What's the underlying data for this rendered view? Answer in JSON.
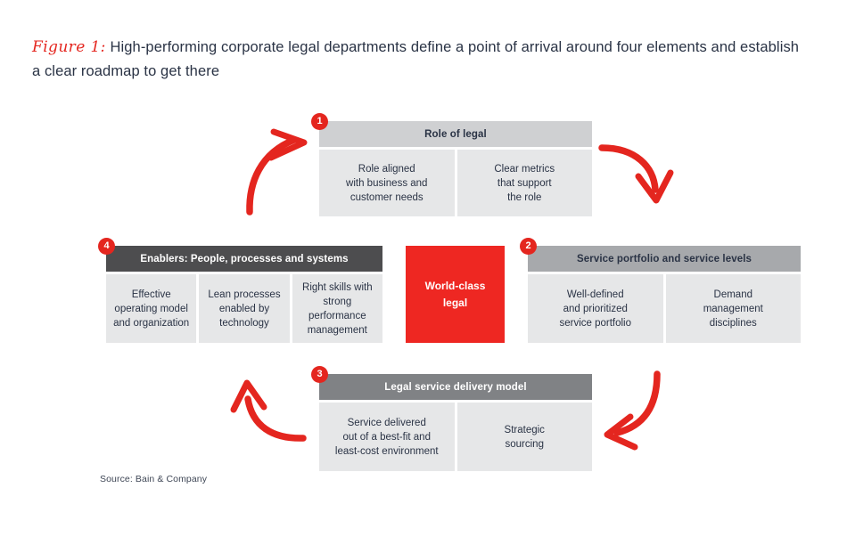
{
  "figure": {
    "label": "Figure 1:",
    "title": "High-performing corporate legal departments define a point of arrival around four elements and establish a clear roadmap to get there",
    "source": "Source: Bain & Company"
  },
  "colors": {
    "accent_red": "#e4261f",
    "center_red": "#ee2722",
    "header_light": "#cfd0d2",
    "header_medium": "#a7a9ac",
    "header_dark": "#808285",
    "header_darkest": "#4d4d4f",
    "cell_gray": "#e6e7e8",
    "text_navy": "#2a3345"
  },
  "center": {
    "line1": "World-class",
    "line2": "legal"
  },
  "panels": [
    {
      "number": "1",
      "title": "Role of legal",
      "position": "top",
      "header_style": "light",
      "cells": [
        "Role aligned with business and customer needs",
        "Clear metrics that support the role"
      ],
      "cell_lines": [
        [
          "Role aligned",
          "with business and",
          "customer needs"
        ],
        [
          "Clear metrics",
          "that support",
          "the role"
        ]
      ]
    },
    {
      "number": "2",
      "title": "Service portfolio and service levels",
      "position": "right",
      "header_style": "medium",
      "cells": [
        "Well-defined and prioritized service portfolio",
        "Demand management disciplines"
      ],
      "cell_lines": [
        [
          "Well-defined",
          "and prioritized",
          "service portfolio"
        ],
        [
          "Demand",
          "management",
          "disciplines"
        ]
      ]
    },
    {
      "number": "3",
      "title": "Legal service delivery model",
      "position": "bottom",
      "header_style": "dark",
      "cells": [
        "Service delivered out of a best-fit and least-cost environment",
        "Strategic sourcing"
      ],
      "cell_lines": [
        [
          "Service delivered",
          "out of a best-fit and",
          "least-cost environment"
        ],
        [
          "Strategic",
          "sourcing"
        ]
      ]
    },
    {
      "number": "4",
      "title": "Enablers: People, processes and systems",
      "position": "left",
      "header_style": "darkest",
      "cells": [
        "Effective operating model and organization",
        "Lean processes enabled by technology",
        "Right skills with strong performance management"
      ],
      "cell_lines": [
        [
          "Effective",
          "operating model",
          "and organization"
        ],
        [
          "Lean processes",
          "enabled by",
          "technology"
        ],
        [
          "Right skills with",
          "strong performance",
          "management"
        ]
      ]
    }
  ],
  "arrows": [
    {
      "name": "arrow-left-to-top",
      "direction": "up-right"
    },
    {
      "name": "arrow-top-to-right",
      "direction": "down-right"
    },
    {
      "name": "arrow-right-to-bottom",
      "direction": "down-left"
    },
    {
      "name": "arrow-bottom-to-left",
      "direction": "up-left"
    }
  ]
}
